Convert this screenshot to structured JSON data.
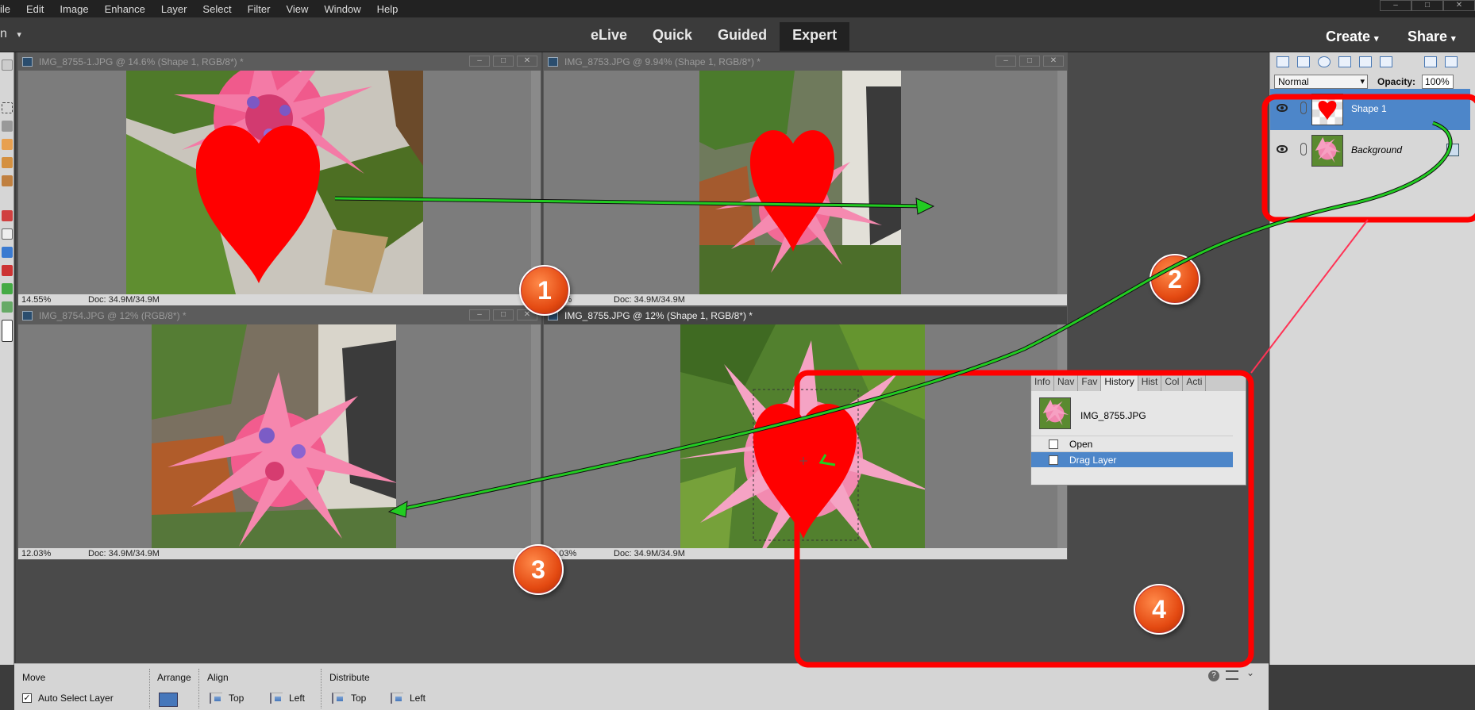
{
  "menu": [
    "ile",
    "Edit",
    "Image",
    "Enhance",
    "Layer",
    "Select",
    "Filter",
    "View",
    "Window",
    "Help"
  ],
  "mode_tabs": {
    "elive": "eLive",
    "quick": "Quick",
    "guided": "Guided",
    "expert": "Expert"
  },
  "mode_left": "n",
  "create_label": "Create",
  "share_label": "Share",
  "documents": [
    {
      "title": "IMG_8755-1.JPG @ 14.6% (Shape 1, RGB/8*) *",
      "zoom": "14.55%",
      "doc": "Doc: 34.9M/34.9M",
      "active": false
    },
    {
      "title": "IMG_8753.JPG @ 9.94% (Shape 1, RGB/8*) *",
      "zoom": "9.94%",
      "doc": "Doc: 34.9M/34.9M",
      "active": false
    },
    {
      "title": "IMG_8754.JPG @ 12% (RGB/8*) *",
      "zoom": "12.03%",
      "doc": "Doc: 34.9M/34.9M",
      "active": false
    },
    {
      "title": "IMG_8755.JPG @ 12% (Shape 1, RGB/8*) *",
      "zoom": "12.03%",
      "doc": "Doc: 34.9M/34.9M",
      "active": true
    }
  ],
  "badges": [
    "1",
    "2",
    "3",
    "4"
  ],
  "layers_panel": {
    "blend_mode": "Normal",
    "opacity_label": "Opacity:",
    "opacity_value": "100%",
    "layers": [
      {
        "name": "Shape 1",
        "selected": true
      },
      {
        "name": "Background",
        "selected": false
      }
    ]
  },
  "history_panel": {
    "tabs": [
      "Info",
      "Nav",
      "Fav",
      "History",
      "Hist",
      "Col",
      "Acti"
    ],
    "active_tab": "History",
    "snapshot": "IMG_8755.JPG",
    "items": [
      {
        "label": "Open",
        "selected": false
      },
      {
        "label": "Drag Layer",
        "selected": true
      }
    ]
  },
  "options_bar": {
    "move_label": "Move",
    "auto_select": "Auto Select Layer",
    "arrange_label": "Arrange",
    "align_label": "Align",
    "align_top": "Top",
    "align_left": "Left",
    "distribute_label": "Distribute",
    "distribute_top": "Top",
    "distribute_left": "Left"
  },
  "colors": {
    "highlight_red": "#ff0000",
    "arrow_green": "#22cc22",
    "selection_blue": "#4d86c9",
    "heart_red": "#ff0000"
  },
  "icons": [
    "eye-icon",
    "link-icon",
    "lock-icon",
    "trash-icon",
    "help-icon",
    "panel-menu-icon"
  ]
}
